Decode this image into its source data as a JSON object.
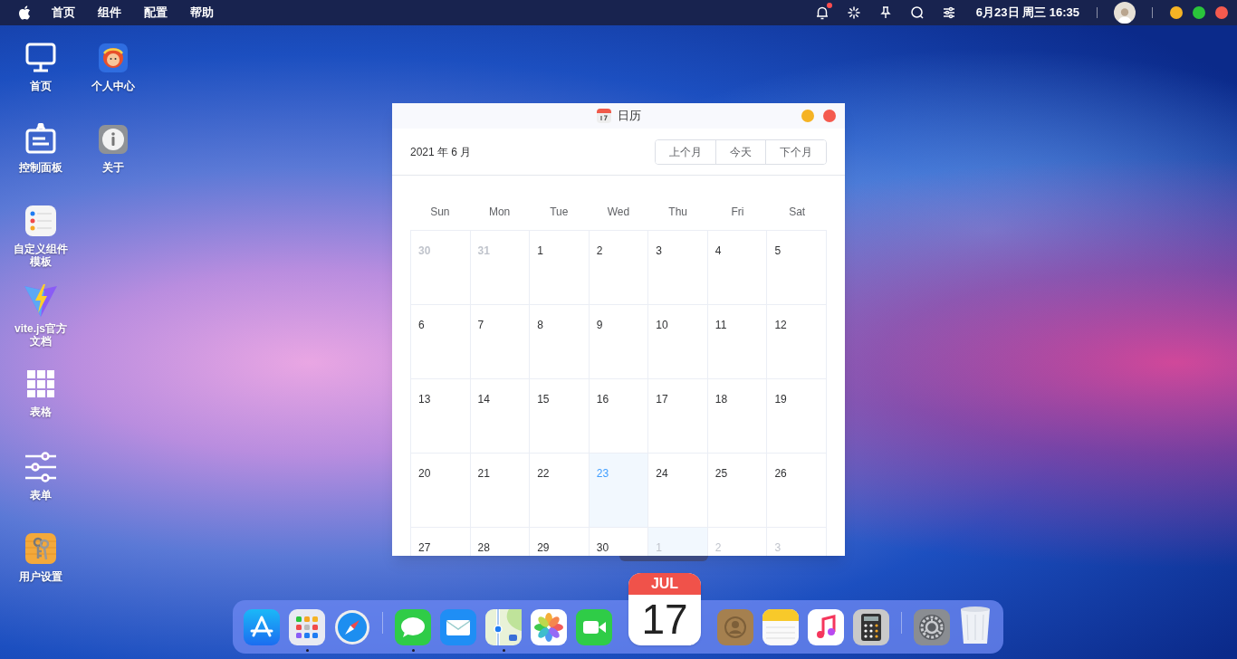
{
  "menubar": {
    "menus": [
      "首页",
      "组件",
      "配置",
      "帮助"
    ],
    "notification_badge": true,
    "clock": "6月23日 周三 16:35"
  },
  "desktop": {
    "columns": [
      [
        {
          "label": "首页",
          "kind": "monitor"
        },
        {
          "label": "控制面板",
          "kind": "signboard"
        },
        {
          "label": "自定义组件模板",
          "kind": "reminders"
        },
        {
          "label": "vite.js官方文档",
          "kind": "vite"
        },
        {
          "label": "表格",
          "kind": "grid"
        },
        {
          "label": "表单",
          "kind": "sliders"
        },
        {
          "label": "用户设置",
          "kind": "keys"
        }
      ],
      [
        {
          "label": "个人中心",
          "kind": "avatar-app"
        },
        {
          "label": "关于",
          "kind": "info"
        }
      ]
    ]
  },
  "calendar_window": {
    "title": "日历",
    "month_label": "2021 年 6 月",
    "buttons": [
      "上个月",
      "今天",
      "下个月"
    ],
    "weekdays": [
      "Sun",
      "Mon",
      "Tue",
      "Wed",
      "Thu",
      "Fri",
      "Sat"
    ],
    "weeks": [
      [
        {
          "day": "30",
          "in_month": false,
          "today": false,
          "selected": false
        },
        {
          "day": "31",
          "in_month": false,
          "today": false,
          "selected": false
        },
        {
          "day": "1",
          "in_month": true,
          "today": false,
          "selected": false
        },
        {
          "day": "2",
          "in_month": true,
          "today": false,
          "selected": false
        },
        {
          "day": "3",
          "in_month": true,
          "today": false,
          "selected": false
        },
        {
          "day": "4",
          "in_month": true,
          "today": false,
          "selected": false
        },
        {
          "day": "5",
          "in_month": true,
          "today": false,
          "selected": false
        }
      ],
      [
        {
          "day": "6",
          "in_month": true,
          "today": false,
          "selected": false
        },
        {
          "day": "7",
          "in_month": true,
          "today": false,
          "selected": false
        },
        {
          "day": "8",
          "in_month": true,
          "today": false,
          "selected": false
        },
        {
          "day": "9",
          "in_month": true,
          "today": false,
          "selected": false
        },
        {
          "day": "10",
          "in_month": true,
          "today": false,
          "selected": false
        },
        {
          "day": "11",
          "in_month": true,
          "today": false,
          "selected": false
        },
        {
          "day": "12",
          "in_month": true,
          "today": false,
          "selected": false
        }
      ],
      [
        {
          "day": "13",
          "in_month": true,
          "today": false,
          "selected": false
        },
        {
          "day": "14",
          "in_month": true,
          "today": false,
          "selected": false
        },
        {
          "day": "15",
          "in_month": true,
          "today": false,
          "selected": false
        },
        {
          "day": "16",
          "in_month": true,
          "today": false,
          "selected": false
        },
        {
          "day": "17",
          "in_month": true,
          "today": false,
          "selected": false
        },
        {
          "day": "18",
          "in_month": true,
          "today": false,
          "selected": false
        },
        {
          "day": "19",
          "in_month": true,
          "today": false,
          "selected": false
        }
      ],
      [
        {
          "day": "20",
          "in_month": true,
          "today": false,
          "selected": false
        },
        {
          "day": "21",
          "in_month": true,
          "today": false,
          "selected": false
        },
        {
          "day": "22",
          "in_month": true,
          "today": false,
          "selected": false
        },
        {
          "day": "23",
          "in_month": true,
          "today": true,
          "selected": true
        },
        {
          "day": "24",
          "in_month": true,
          "today": false,
          "selected": false
        },
        {
          "day": "25",
          "in_month": true,
          "today": false,
          "selected": false
        },
        {
          "day": "26",
          "in_month": true,
          "today": false,
          "selected": false
        }
      ],
      [
        {
          "day": "27",
          "in_month": true,
          "today": false,
          "selected": false
        },
        {
          "day": "28",
          "in_month": true,
          "today": false,
          "selected": false
        },
        {
          "day": "29",
          "in_month": true,
          "today": false,
          "selected": false
        },
        {
          "day": "30",
          "in_month": true,
          "today": false,
          "selected": false
        },
        {
          "day": "1",
          "in_month": false,
          "today": false,
          "selected": true
        },
        {
          "day": "2",
          "in_month": false,
          "today": false,
          "selected": false
        },
        {
          "day": "3",
          "in_month": false,
          "today": false,
          "selected": false
        }
      ]
    ]
  },
  "dock": {
    "items": [
      {
        "kind": "appstore",
        "running": false
      },
      {
        "kind": "launchpad",
        "running": true
      },
      {
        "kind": "safari",
        "running": false
      },
      {
        "kind": "separator"
      },
      {
        "kind": "messages",
        "running": true
      },
      {
        "kind": "mail",
        "running": false
      },
      {
        "kind": "maps",
        "running": true
      },
      {
        "kind": "photos",
        "running": false
      },
      {
        "kind": "facetime",
        "running": false
      },
      {
        "kind": "calendar",
        "running": false,
        "month": "JUL",
        "day": "17"
      },
      {
        "kind": "contacts",
        "running": false
      },
      {
        "kind": "notes",
        "running": false
      },
      {
        "kind": "music",
        "running": false
      },
      {
        "kind": "calculator",
        "running": false
      },
      {
        "kind": "separator"
      },
      {
        "kind": "settings",
        "running": false
      },
      {
        "kind": "trash",
        "running": false
      }
    ]
  }
}
